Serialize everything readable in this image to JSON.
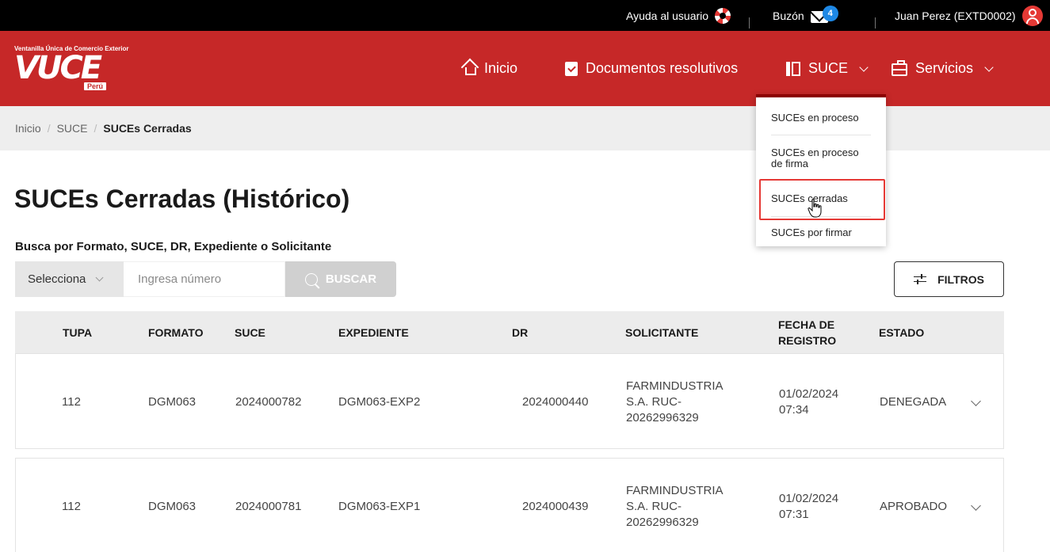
{
  "topbar": {
    "help_label": "Ayuda al usuario",
    "mailbox_label": "Buzón",
    "mailbox_count": "4",
    "user_name": "Juan Perez (EXTD0002)"
  },
  "header": {
    "logo_tagline": "Ventanilla Única de Comercio Exterior",
    "logo_brand": "VUCE",
    "logo_country": "Perú",
    "nav": {
      "home": "Inicio",
      "documents": "Documentos resolutivos",
      "suce": "SUCE",
      "services": "Servicios"
    }
  },
  "breadcrumb": {
    "home": "Inicio",
    "section": "SUCE",
    "current": "SUCEs Cerradas",
    "separator": "/"
  },
  "main": {
    "title": "SUCEs Cerradas (Histórico)",
    "search_label": "Busca por Formato, SUCE, DR, Expediente o Solicitante",
    "select_value": "Selecciona",
    "input_placeholder": "Ingresa número",
    "search_button": "BUSCAR",
    "filter_button": "FILTROS"
  },
  "table": {
    "headers": {
      "tupa": "TUPA",
      "formato": "FORMATO",
      "suce": "SUCE",
      "expediente": "EXPEDIENTE",
      "dr": "DR",
      "solicitante": "SOLICITANTE",
      "fecha_1": "FECHA DE",
      "fecha_2": "REGISTRO",
      "estado": "ESTADO"
    },
    "rows": [
      {
        "tupa": "112",
        "formato": "DGM063",
        "suce": "2024000782",
        "expediente": "DGM063-EXP2",
        "dr": "2024000440",
        "solicitante_1": "FARMINDUSTRIA",
        "solicitante_2": "S.A. RUC-",
        "solicitante_3": "20262996329",
        "fecha_1": "01/02/2024",
        "fecha_2": "07:34",
        "estado": "DENEGADA"
      },
      {
        "tupa": "112",
        "formato": "DGM063",
        "suce": "2024000781",
        "expediente": "DGM063-EXP1",
        "dr": "2024000439",
        "solicitante_1": "FARMINDUSTRIA",
        "solicitante_2": "S.A. RUC-",
        "solicitante_3": "20262996329",
        "fecha_1": "01/02/2024",
        "fecha_2": "07:31",
        "estado": "APROBADO"
      }
    ]
  },
  "suce_menu": {
    "items": [
      {
        "line1": "SUCEs en proceso",
        "line2": ""
      },
      {
        "line1": "SUCEs en proceso",
        "line2": "de firma"
      },
      {
        "line1": "SUCEs cerradas",
        "line2": ""
      },
      {
        "line1": "SUCEs por firmar",
        "line2": ""
      }
    ]
  },
  "colors": {
    "brand_red": "#c62828",
    "topbar_black": "#000000",
    "highlight_red": "#e53935",
    "badge_blue": "#1e88e5"
  },
  "icons": [
    "lifebuoy-icon",
    "mail-icon",
    "user-icon",
    "home-icon",
    "document-check-icon",
    "suce-icon",
    "briefcase-icon",
    "chevron-down-icon",
    "search-icon",
    "tune-icon",
    "pointer-cursor-icon"
  ]
}
